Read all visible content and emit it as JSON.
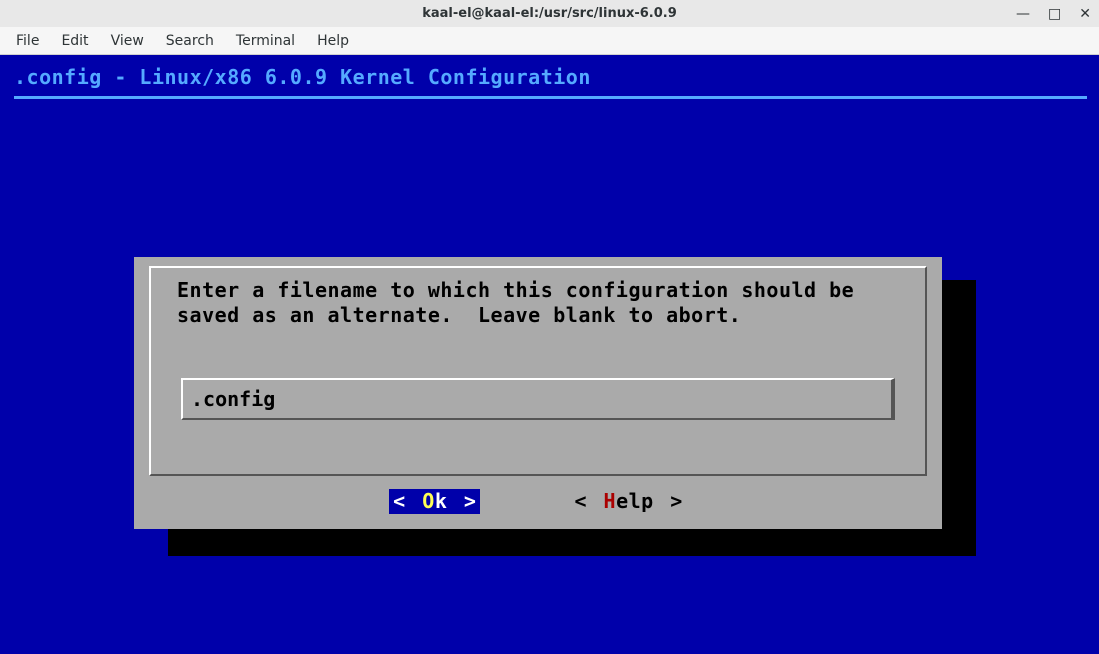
{
  "window": {
    "title": "kaal-el@kaal-el:/usr/src/linux-6.0.9",
    "minimize": "—",
    "maximize": "□",
    "close": "✕"
  },
  "menubar": [
    "File",
    "Edit",
    "View",
    "Search",
    "Terminal",
    "Help"
  ],
  "header": ".config - Linux/x86 6.0.9 Kernel Configuration",
  "dialog": {
    "prompt": "Enter a filename to which this configuration should be saved as an alternate.  Leave blank to abort.",
    "input_value": ".config",
    "ok": {
      "open": "<",
      "pre": "O",
      "rest": "k",
      "close": ">"
    },
    "help": {
      "open": "<",
      "pre": "H",
      "rest": "elp",
      "close": ">"
    }
  }
}
